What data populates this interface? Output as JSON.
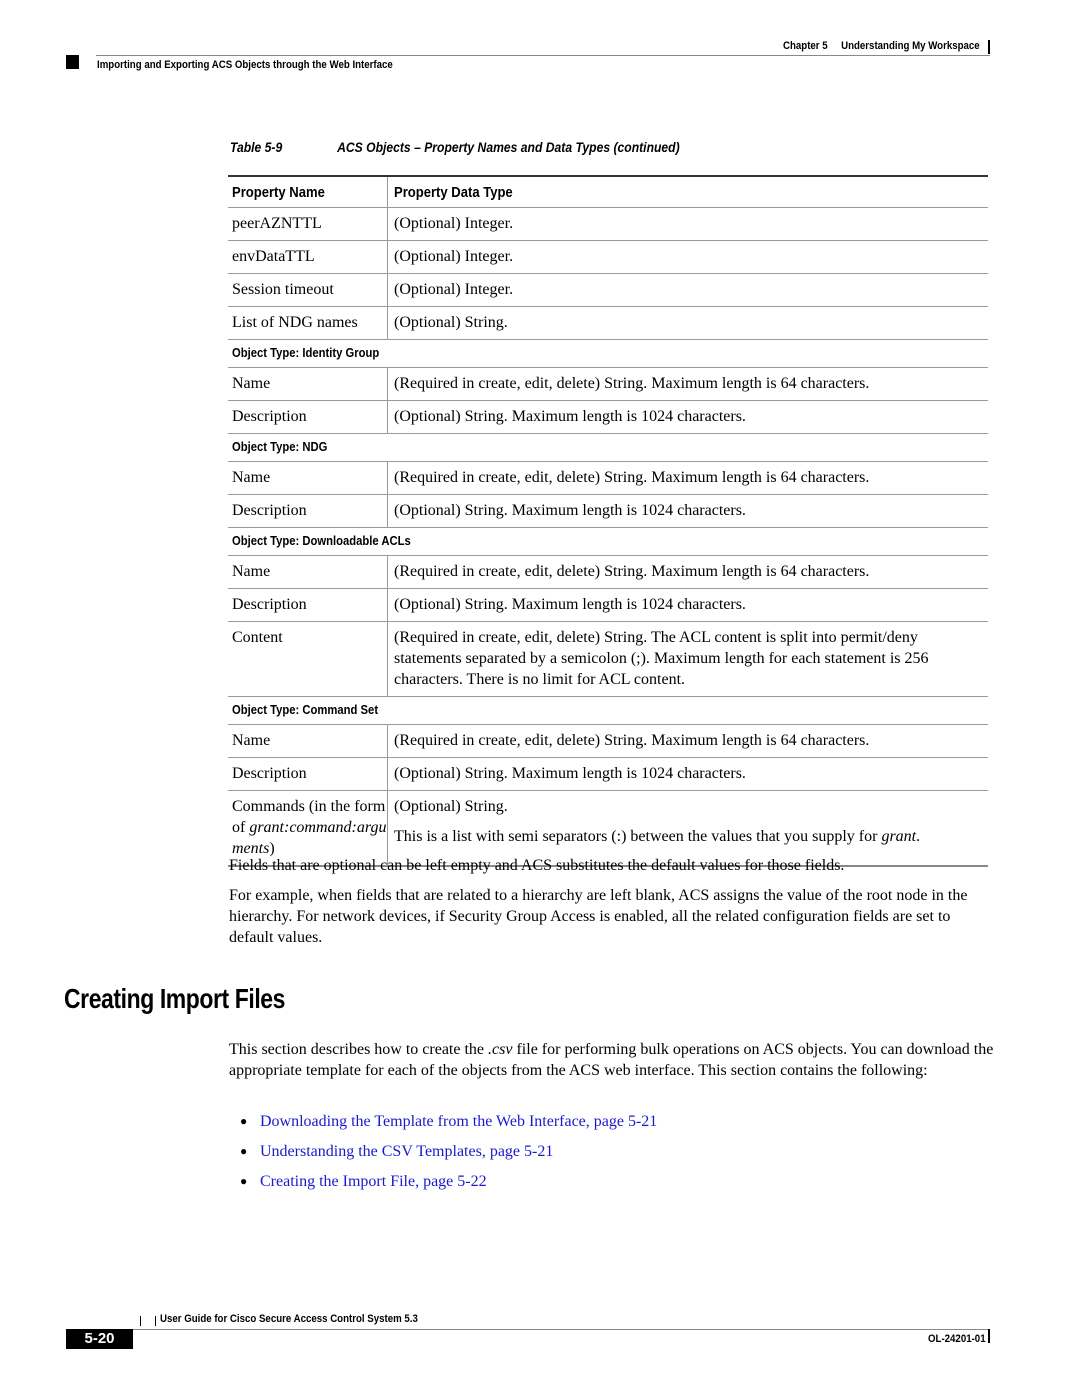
{
  "header": {
    "chapter": "Chapter 5     Understanding My Workspace",
    "section": "Importing and Exporting ACS Objects through the Web Interface"
  },
  "table": {
    "caption_number": "Table 5-9",
    "caption_title": "ACS Objects – Property Names and Data Types (continued)",
    "columns": [
      "Property Name",
      "Property Data Type"
    ],
    "rows_top": [
      {
        "name": "peerAZNTTL",
        "type": "(Optional) Integer."
      },
      {
        "name": "envDataTTL",
        "type": "(Optional) Integer."
      },
      {
        "name": "Session timeout",
        "type": "(Optional) Integer."
      },
      {
        "name": "List of NDG names",
        "type": "(Optional) String."
      }
    ],
    "groups": [
      {
        "title": "Object Type: Identity Group",
        "rows": [
          {
            "name": "Name",
            "type": "(Required in create, edit, delete) String. Maximum length is 64 characters."
          },
          {
            "name": "Description",
            "type": "(Optional) String. Maximum length is 1024 characters."
          }
        ]
      },
      {
        "title": "Object Type: NDG",
        "rows": [
          {
            "name": "Name",
            "type": "(Required in create, edit, delete) String. Maximum length is 64 characters."
          },
          {
            "name": "Description",
            "type": "(Optional) String. Maximum length is 1024 characters."
          }
        ]
      },
      {
        "title": "Object Type: Downloadable ACLs",
        "rows": [
          {
            "name": "Name",
            "type": "(Required in create, edit, delete) String. Maximum length is 64 characters."
          },
          {
            "name": "Description",
            "type": "(Optional) String. Maximum length is 1024 characters."
          },
          {
            "name": "Content",
            "type": "(Required in create, edit, delete) String. The ACL content is split into permit/deny statements separated by a semicolon (;). Maximum length for each statement is 256 characters. There is no limit for ACL content."
          }
        ]
      },
      {
        "title": "Object Type: Command Set",
        "rows": [
          {
            "name": "Name",
            "type": "(Required in create, edit, delete) String. Maximum length is 64 characters."
          },
          {
            "name": "Description",
            "type": "(Optional) String. Maximum length is 1024 characters."
          }
        ]
      }
    ],
    "commands_row": {
      "name_prefix": "Commands (in the form of ",
      "name_italic": "grant:command:arguments",
      "name_suffix": ")",
      "type_line1": "(Optional) String.",
      "type_line2": "This is a list with semi separators (:) between the values that you supply for ",
      "type_line2_italic": "grant",
      "type_line2_end": "."
    }
  },
  "body": {
    "p1": "Fields that are optional can be left empty and ACS substitutes the default values for those fields.",
    "p2": "For example, when fields that are related to a hierarchy are left blank, ACS assigns the value of the root node in the hierarchy. For network devices, if Security Group Access is enabled, all the related configuration fields are set to default values."
  },
  "section": {
    "heading": "Creating Import Files",
    "intro_a": "This section describes how to create the ",
    "intro_italic": ".csv",
    "intro_b": " file for performing bulk operations on ACS objects. You can download the appropriate template for each of the objects from the ACS web interface. This section contains the following:",
    "links": [
      "Downloading the Template from the Web Interface, page 5-21",
      "Understanding the CSV Templates, page 5-21",
      "Creating the Import File, page 5-22"
    ],
    "link_color": "#1a1acc"
  },
  "footer": {
    "title": "User Guide for Cisco Secure Access Control System 5.3",
    "page_number": "5-20",
    "doc_number": "OL-24201-01"
  }
}
